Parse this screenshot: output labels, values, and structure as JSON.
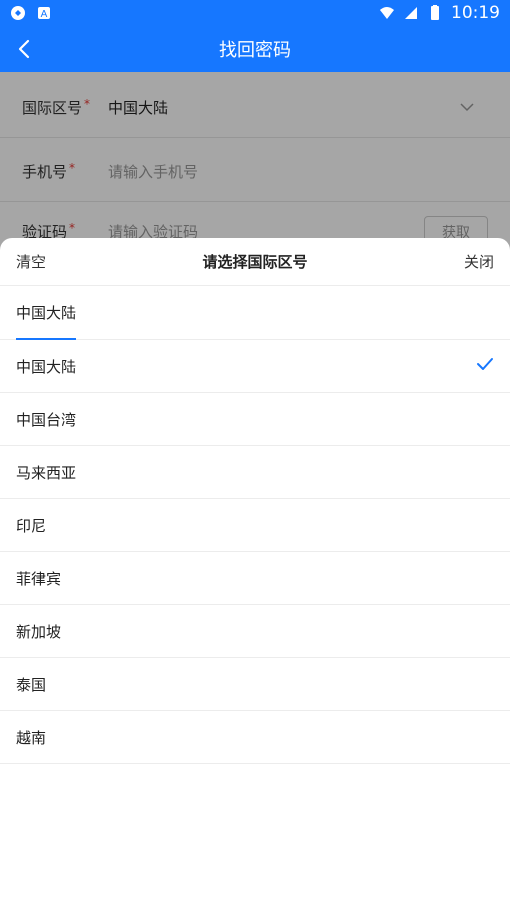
{
  "status_bar": {
    "time": "10:19",
    "left_icons": [
      "sync-icon",
      "a-badge-icon"
    ],
    "right_icons": [
      "wifi-icon",
      "signal-icon",
      "battery-icon"
    ]
  },
  "app_bar": {
    "title": "找回密码",
    "back_icon": "back-arrow-icon"
  },
  "form": {
    "rows": [
      {
        "label": "国际区号",
        "required_mark": "*",
        "value": "中国大陆"
      },
      {
        "label": "手机号",
        "required_mark": "*",
        "placeholder": "请输入手机号"
      },
      {
        "label": "验证码",
        "required_mark": "*",
        "placeholder": "请输入验证码",
        "button": "获取"
      }
    ]
  },
  "picker": {
    "clear_label": "清空",
    "title": "请选择国际区号",
    "close_label": "关闭",
    "tab_label": "中国大陆",
    "selected_index": 0,
    "options": [
      {
        "label": "中国大陆"
      },
      {
        "label": "中国台湾"
      },
      {
        "label": "马来西亚"
      },
      {
        "label": "印尼"
      },
      {
        "label": "菲律宾"
      },
      {
        "label": "新加坡"
      },
      {
        "label": "泰国"
      },
      {
        "label": "越南"
      }
    ]
  },
  "colors": {
    "primary": "#1677ff",
    "required": "#e53935"
  }
}
